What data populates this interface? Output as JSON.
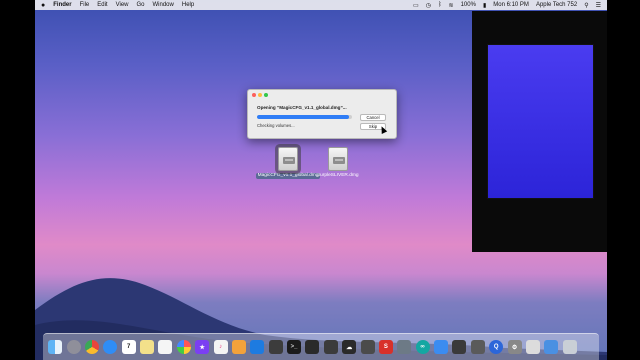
{
  "menubar": {
    "apple_icon": "",
    "app_name": "Finder",
    "menus": [
      "File",
      "Edit",
      "View",
      "Go",
      "Window",
      "Help"
    ],
    "battery": "100%",
    "clock": "Mon 6:10 PM",
    "user": "Apple Tech 752"
  },
  "dialog": {
    "title": "Opening “MagicCFG_v1.1_global.dmg”...",
    "status": "Checking volumes...",
    "cancel_label": "Cancel",
    "skip_label": "Skip",
    "progress": 0.97,
    "progress_color": "#2f7df6"
  },
  "desktop": {
    "icons": [
      {
        "label": "MagicCFG_v1.1_global.dmg",
        "selected": true
      },
      {
        "label": "purpleSLIVER.dmg",
        "selected": false
      }
    ]
  },
  "dock": {
    "apps": [
      "finder-icon",
      "launchpad-icon",
      "chrome-icon",
      "safari-icon",
      "calendar-icon",
      "notes-icon",
      "reminders-icon",
      "photos-icon",
      "imovie-icon",
      "itunes-icon",
      "ibooks-icon",
      "xcode-icon",
      "pen-icon",
      "terminal-icon",
      "app-icon",
      "text-icon",
      "cloud-icon",
      "ip-icon",
      "s-icon",
      "system-icon",
      "arduino-icon",
      "icloud-icon",
      "controller-icon",
      "window-icon",
      "quicktime-icon",
      "preferences-icon",
      "printer-icon",
      "downloads-icon",
      "trash-icon"
    ],
    "calendar_day": "7",
    "s_glyph": "S"
  }
}
